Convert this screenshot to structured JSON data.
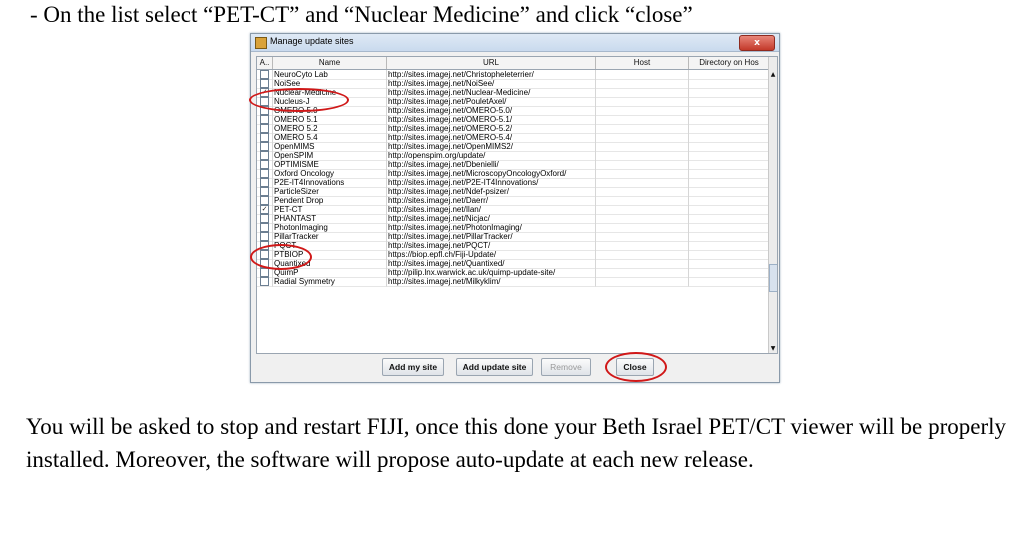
{
  "instruction": "- On the list select “PET-CT” and “Nuclear Medicine” and click “close”",
  "dialog": {
    "title": "Manage update sites",
    "close_glyph": "x",
    "columns": [
      "A..",
      "Name",
      "URL",
      "Host",
      "Directory on Hos"
    ],
    "rows": [
      {
        "name": "NeuroCyto Lab",
        "url": "http://sites.imagej.net/Christopheleterrier/",
        "checked": false
      },
      {
        "name": "NoiSee",
        "url": "http://sites.imagej.net/NoiSee/",
        "checked": false
      },
      {
        "name": "Nuclear-Medicine",
        "url": "http://sites.imagej.net/Nuclear-Medicine/",
        "checked": true
      },
      {
        "name": "Nucleus-J",
        "url": "http://sites.imagej.net/PouletAxel/",
        "checked": false
      },
      {
        "name": "OMERO 5.0",
        "url": "http://sites.imagej.net/OMERO-5.0/",
        "checked": false
      },
      {
        "name": "OMERO 5.1",
        "url": "http://sites.imagej.net/OMERO-5.1/",
        "checked": false
      },
      {
        "name": "OMERO 5.2",
        "url": "http://sites.imagej.net/OMERO-5.2/",
        "checked": false
      },
      {
        "name": "OMERO 5.4",
        "url": "http://sites.imagej.net/OMERO-5.4/",
        "checked": false
      },
      {
        "name": "OpenMIMS",
        "url": "http://sites.imagej.net/OpenMIMS2/",
        "checked": false
      },
      {
        "name": "OpenSPIM",
        "url": "http://openspim.org/update/",
        "checked": false
      },
      {
        "name": "OPTIMISME",
        "url": "http://sites.imagej.net/Dbenielli/",
        "checked": false
      },
      {
        "name": "Oxford Oncology",
        "url": "http://sites.imagej.net/MicroscopyOncologyOxford/",
        "checked": false
      },
      {
        "name": "P2E-IT4Innovations",
        "url": "http://sites.imagej.net/P2E-IT4Innovations/",
        "checked": false
      },
      {
        "name": "ParticleSizer",
        "url": "http://sites.imagej.net/Ndef-psizer/",
        "checked": false
      },
      {
        "name": "Pendent Drop",
        "url": "http://sites.imagej.net/Daerr/",
        "checked": false
      },
      {
        "name": "PET-CT",
        "url": "http://sites.imagej.net/Ilan/",
        "checked": true
      },
      {
        "name": "PHANTAST",
        "url": "http://sites.imagej.net/Nicjac/",
        "checked": false
      },
      {
        "name": "PhotonImaging",
        "url": "http://sites.imagej.net/PhotonImaging/",
        "checked": false
      },
      {
        "name": "PillarTracker",
        "url": "http://sites.imagej.net/PillarTracker/",
        "checked": false
      },
      {
        "name": "PQCT",
        "url": "http://sites.imagej.net/PQCT/",
        "checked": false
      },
      {
        "name": "PTBIOP",
        "url": "https://biop.epfl.ch/Fiji-Update/",
        "checked": false
      },
      {
        "name": "Quantixed",
        "url": "http://sites.imagej.net/Quantixed/",
        "checked": false
      },
      {
        "name": "QuimP",
        "url": "http://pilip.lnx.warwick.ac.uk/quimp-update-site/",
        "checked": false
      },
      {
        "name": "Radial Symmetry",
        "url": "http://sites.imagej.net/Milkyklim/",
        "checked": false
      }
    ],
    "buttons": {
      "add_my_site": "Add my site",
      "add_update_site": "Add update site",
      "remove": "Remove",
      "close": "Close"
    }
  },
  "paragraph": "You will be asked to stop and restart FIJI, once this done your Beth Israel PET/CT viewer will be properly installed. Moreover, the software will propose auto-update at each new release.",
  "colors": {
    "highlight_ring": "#d01818"
  }
}
